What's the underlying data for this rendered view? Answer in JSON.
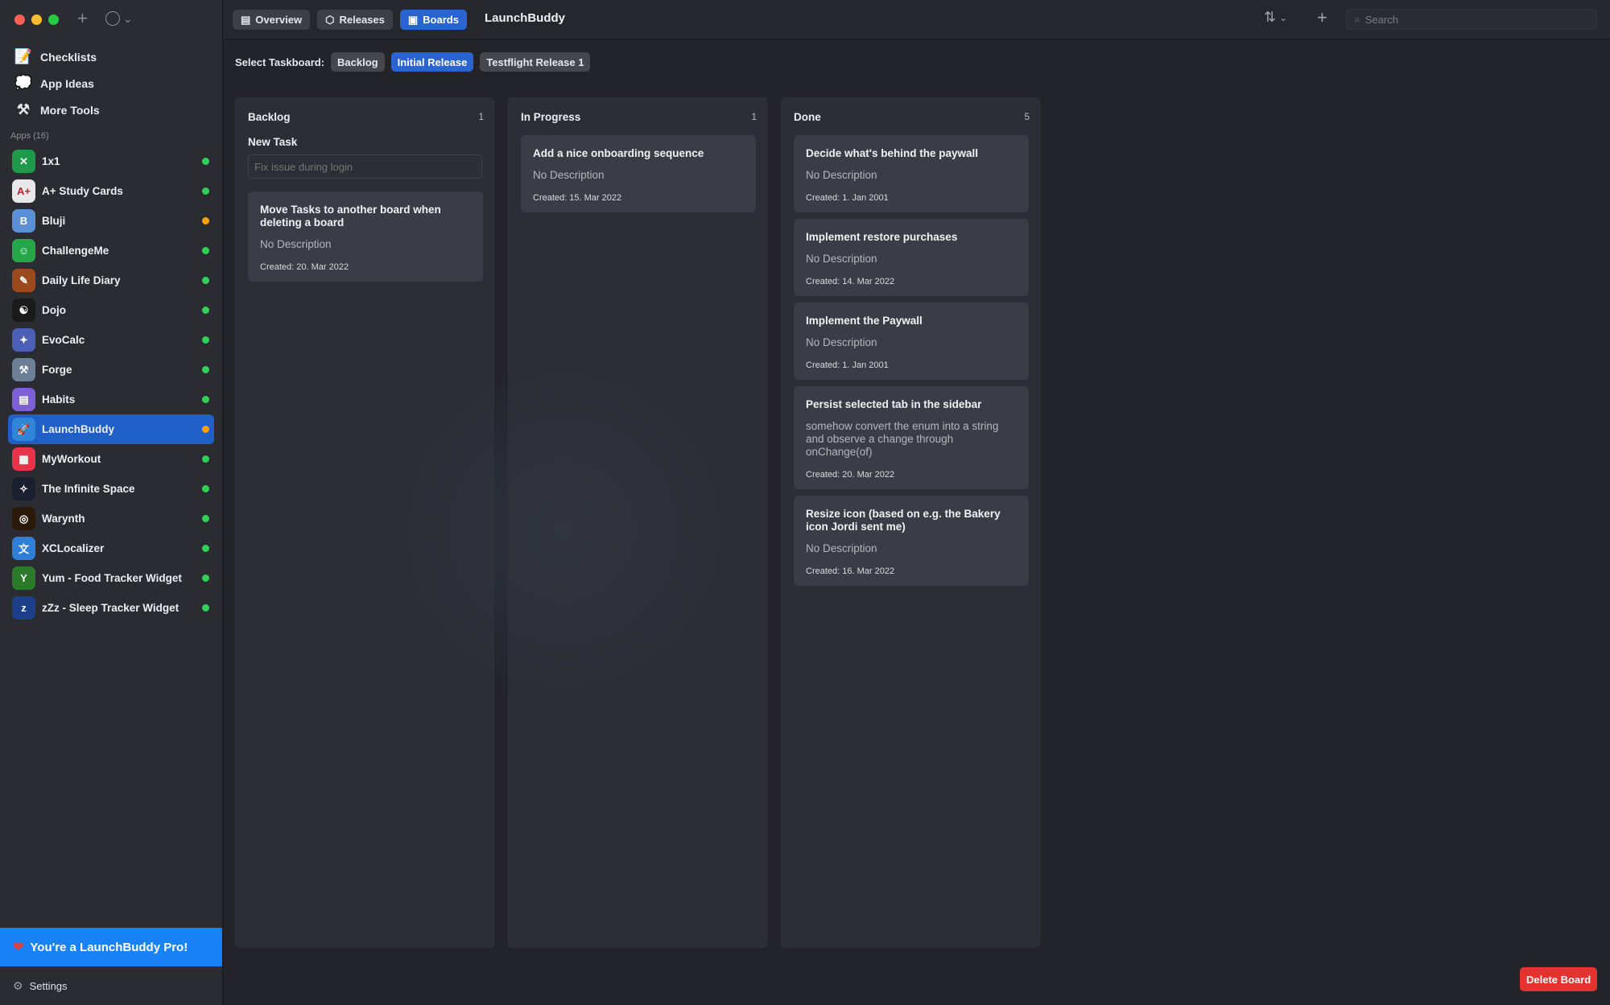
{
  "sidebar": {
    "tools": [
      {
        "label": "Checklists",
        "icon": "checklist-icon",
        "glyph": "📝"
      },
      {
        "label": "App Ideas",
        "icon": "thought-bubble-icon",
        "glyph": "💭"
      },
      {
        "label": "More Tools",
        "icon": "tools-icon",
        "glyph": "⚒"
      }
    ],
    "apps_label": "Apps (16)",
    "apps": [
      {
        "name": "1x1",
        "bg": "#1f9a4a",
        "glyph": "✕",
        "status": "#30d158"
      },
      {
        "name": "A+ Study Cards",
        "bg": "#e8e8ea",
        "glyph": "A+",
        "status": "#30d158"
      },
      {
        "name": "Bluji",
        "bg": "#5b8fd6",
        "glyph": "B",
        "status": "#ff9f0a"
      },
      {
        "name": "ChallengeMe",
        "bg": "#26a64a",
        "glyph": "☺",
        "status": "#30d158"
      },
      {
        "name": "Daily Life Diary",
        "bg": "#9b4a1e",
        "glyph": "✎",
        "status": "#30d158"
      },
      {
        "name": "Dojo",
        "bg": "#1a1a1a",
        "glyph": "☯",
        "status": "#30d158"
      },
      {
        "name": "EvoCalc",
        "bg": "#4b5fb6",
        "glyph": "✦",
        "status": "#30d158"
      },
      {
        "name": "Forge",
        "bg": "#6b7f96",
        "glyph": "⚒",
        "status": "#30d158"
      },
      {
        "name": "Habits",
        "bg": "#7d5fd6",
        "glyph": "▤",
        "status": "#30d158"
      },
      {
        "name": "LaunchBuddy",
        "bg": "#2f86d8",
        "glyph": "🚀",
        "status": "#ff9f0a",
        "selected": true
      },
      {
        "name": "MyWorkout",
        "bg": "#e8334a",
        "glyph": "▦",
        "status": "#30d158"
      },
      {
        "name": "The Infinite Space",
        "bg": "#1a2030",
        "glyph": "✧",
        "status": "#30d158"
      },
      {
        "name": "Warynth",
        "bg": "#2b1a0a",
        "glyph": "◎",
        "status": "#30d158"
      },
      {
        "name": "XCLocalizer",
        "bg": "#2f7ed8",
        "glyph": "文",
        "status": "#30d158"
      },
      {
        "name": "Yum - Food Tracker Widget",
        "bg": "#2a7a2a",
        "glyph": "Y",
        "status": "#30d158"
      },
      {
        "name": "zZz - Sleep Tracker Widget",
        "bg": "#1d3f8a",
        "glyph": "z",
        "status": "#30d158"
      }
    ],
    "pro_banner": "You're a LaunchBuddy Pro!",
    "settings_label": "Settings"
  },
  "toolbar": {
    "tabs": [
      {
        "label": "Overview",
        "glyph": "▤"
      },
      {
        "label": "Releases",
        "glyph": "⬡"
      },
      {
        "label": "Boards",
        "glyph": "▣",
        "active": true
      }
    ],
    "title": "LaunchBuddy",
    "search_placeholder": "Search"
  },
  "taskboards": {
    "label": "Select Taskboard:",
    "options": [
      {
        "label": "Backlog"
      },
      {
        "label": "Initial Release",
        "active": true
      },
      {
        "label": "Testflight Release 1"
      }
    ]
  },
  "columns": [
    {
      "title": "Backlog",
      "count": "1",
      "new_task_label": "New Task",
      "new_task_placeholder": "Fix issue during login",
      "cards": [
        {
          "title": "Move Tasks to another board when deleting a board",
          "description": "No Description",
          "created": "Created: 20. Mar 2022"
        }
      ]
    },
    {
      "title": "In Progress",
      "count": "1",
      "cards": [
        {
          "title": "Add a nice onboarding sequence",
          "description": "No Description",
          "created": "Created: 15. Mar 2022"
        }
      ]
    },
    {
      "title": "Done",
      "count": "5",
      "cards": [
        {
          "title": "Decide what's behind the paywall",
          "description": "No Description",
          "created": "Created: 1. Jan 2001"
        },
        {
          "title": "Implement restore purchases",
          "description": "No Description",
          "created": "Created: 14. Mar 2022"
        },
        {
          "title": "Implement the Paywall",
          "description": "No Description",
          "created": "Created: 1. Jan 2001"
        },
        {
          "title": "Persist selected tab in the sidebar",
          "description": "somehow convert the enum into a string and observe a change through onChange(of)",
          "created": "Created: 20. Mar 2022"
        },
        {
          "title": "Resize icon (based on e.g. the Bakery icon Jordi sent me)",
          "description": "No Description",
          "created": "Created: 16. Mar 2022"
        }
      ]
    }
  ],
  "delete_board_label": "Delete Board"
}
